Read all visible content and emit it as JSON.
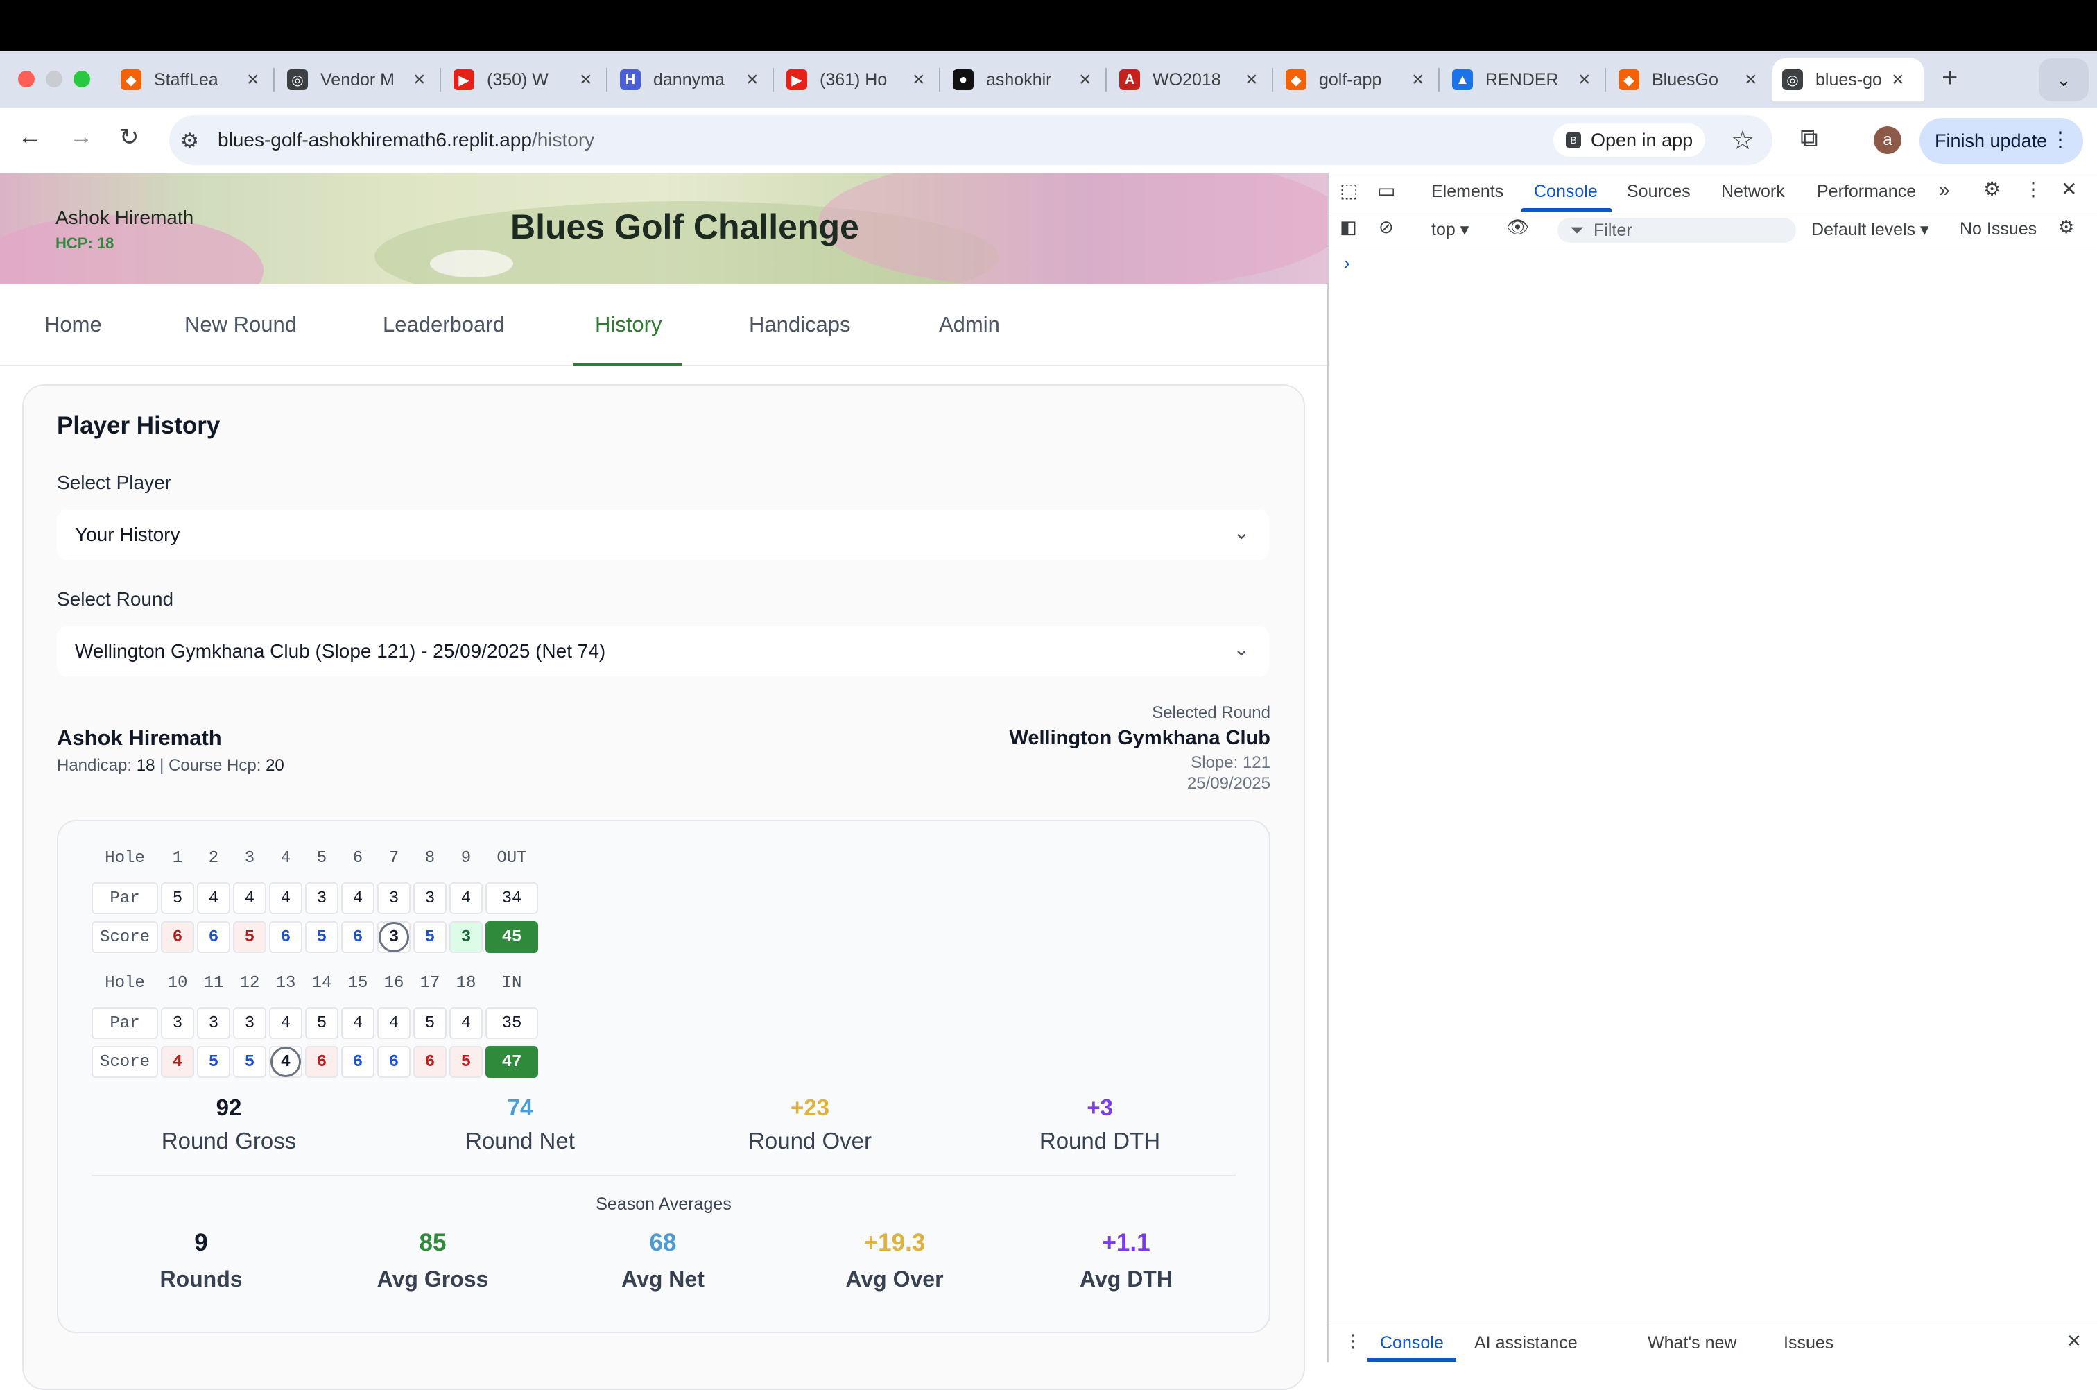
{
  "browser": {
    "tabs": [
      {
        "title": "StaffLea",
        "icon": "replit-icon",
        "color": "#f26207"
      },
      {
        "title": "Vendor M",
        "icon": "globe-icon",
        "color": "#3c4043"
      },
      {
        "title": "(350) W",
        "icon": "youtube-icon",
        "color": "#e62117"
      },
      {
        "title": "dannyma",
        "icon": "h-icon",
        "color": "#4a5fd6"
      },
      {
        "title": "(361) Ho",
        "icon": "youtube-icon",
        "color": "#e62117"
      },
      {
        "title": "ashokhir",
        "icon": "github-icon",
        "color": "#111111"
      },
      {
        "title": "WO2018",
        "icon": "pdf-icon",
        "color": "#c5221f"
      },
      {
        "title": "golf-app",
        "icon": "replit-icon",
        "color": "#f26207"
      },
      {
        "title": "RENDER",
        "icon": "drive-icon",
        "color": "#1a73e8"
      },
      {
        "title": "BluesGo",
        "icon": "replit-icon",
        "color": "#f26207"
      },
      {
        "title": "blues-go",
        "icon": "globe-icon",
        "color": "#3c4043"
      }
    ],
    "url_host": "blues-golf-ashokhiremath6.replit.app",
    "url_path": "/history",
    "open_in_app": "Open in app",
    "avatar_letter": "a",
    "finish_update": "Finish update"
  },
  "app": {
    "user_name": "Ashok Hiremath",
    "user_hcp": "HCP: 18",
    "title": "Blues Golf Challenge",
    "nav": [
      "Home",
      "New Round",
      "Leaderboard",
      "History",
      "Handicaps",
      "Admin"
    ],
    "active_nav": "History"
  },
  "history": {
    "title": "Player History",
    "select_player_label": "Select Player",
    "select_player_value": "Your History",
    "select_round_label": "Select Round",
    "select_round_value": "Wellington Gymkhana Club (Slope 121) - 25/09/2025 (Net 74)",
    "player_name": "Ashok Hiremath",
    "handicap_label": "Handicap: ",
    "handicap_value": "18",
    "course_hcp_label": " | Course Hcp: ",
    "course_hcp_value": "20",
    "selected_round_label": "Selected Round",
    "course": "Wellington Gymkhana Club",
    "slope": "Slope: 121",
    "date": "25/09/2025"
  },
  "scorecard": {
    "hole_label": "Hole",
    "par_label": "Par",
    "score_label": "Score",
    "front": {
      "holes": [
        "1",
        "2",
        "3",
        "4",
        "5",
        "6",
        "7",
        "8",
        "9"
      ],
      "total_label": "OUT",
      "par": [
        "5",
        "4",
        "4",
        "4",
        "3",
        "4",
        "3",
        "3",
        "4"
      ],
      "par_total": "34",
      "score": [
        "6",
        "6",
        "5",
        "6",
        "5",
        "6",
        "3",
        "5",
        "3"
      ],
      "score_total": "45"
    },
    "back": {
      "holes": [
        "10",
        "11",
        "12",
        "13",
        "14",
        "15",
        "16",
        "17",
        "18"
      ],
      "total_label": "IN",
      "par": [
        "3",
        "3",
        "3",
        "4",
        "5",
        "4",
        "4",
        "5",
        "4"
      ],
      "par_total": "35",
      "score": [
        "4",
        "5",
        "5",
        "4",
        "6",
        "6",
        "6",
        "6",
        "5"
      ],
      "score_total": "47"
    }
  },
  "round_stats": [
    {
      "value": "92",
      "label": "Round Gross",
      "color": "#111827"
    },
    {
      "value": "74",
      "label": "Round Net",
      "color": "#4a9bd8"
    },
    {
      "value": "+23",
      "label": "Round Over",
      "color": "#e0b23a"
    },
    {
      "value": "+3",
      "label": "Round DTH",
      "color": "#7c3aed"
    }
  ],
  "season": {
    "title": "Season Averages",
    "items": [
      {
        "value": "9",
        "label": "Rounds",
        "color": "#111827"
      },
      {
        "value": "85",
        "label": "Avg Gross",
        "color": "#2f8a3c"
      },
      {
        "value": "68",
        "label": "Avg Net",
        "color": "#4a9bd8"
      },
      {
        "value": "+19.3",
        "label": "Avg Over",
        "color": "#e0b23a"
      },
      {
        "value": "+1.1",
        "label": "Avg DTH",
        "color": "#7c3aed"
      }
    ]
  },
  "devtools": {
    "tabs": [
      "Elements",
      "Console",
      "Sources",
      "Network",
      "Performance"
    ],
    "active_tab": "Console",
    "context": "top",
    "filter_placeholder": "Filter",
    "levels": "Default levels",
    "issues": "No Issues",
    "prompt": "›",
    "drawer_tabs": [
      "Console",
      "AI assistance",
      "What's new",
      "Issues"
    ]
  }
}
